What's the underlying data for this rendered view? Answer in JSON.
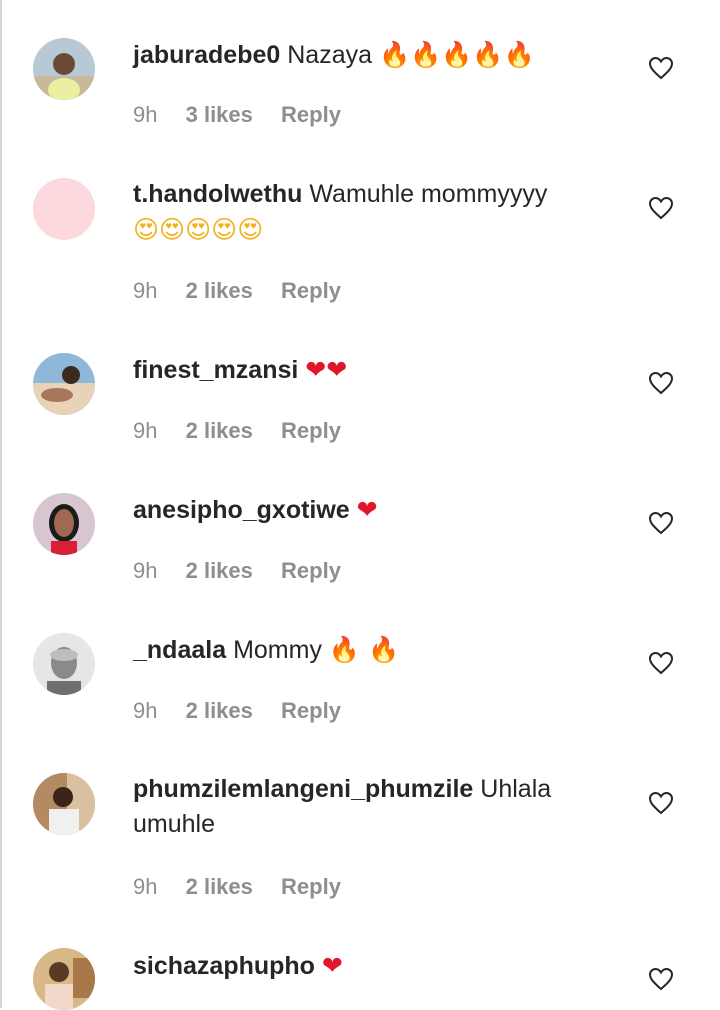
{
  "comments": [
    {
      "username": "jaburadebe0",
      "text": "Nazaya",
      "emoji": "🔥🔥🔥🔥🔥",
      "emoji_kind": "fire",
      "time": "9h",
      "likes": "3 likes",
      "reply": "Reply",
      "avatar_color": "#c9b89a"
    },
    {
      "username": "t.handolwethu",
      "text": "Wamuhle mommyyyy",
      "emoji": "😍😍😍😍😍",
      "emoji_kind": "smile",
      "time": "9h",
      "likes": "2 likes",
      "reply": "Reply",
      "avatar_color": "#fcd9dc"
    },
    {
      "username": "finest_mzansi",
      "text": "",
      "emoji": "❤❤",
      "emoji_kind": "heart",
      "time": "9h",
      "likes": "2 likes",
      "reply": "Reply",
      "avatar_color": "#8fb8d8"
    },
    {
      "username": "anesipho_gxotiwe",
      "text": "",
      "emoji": "❤",
      "emoji_kind": "heart",
      "time": "9h",
      "likes": "2 likes",
      "reply": "Reply",
      "avatar_color": "#c7a9b6"
    },
    {
      "username": "_ndaala",
      "text": "Mommy",
      "emoji": "🔥 🔥",
      "emoji_kind": "fire",
      "time": "9h",
      "likes": "2 likes",
      "reply": "Reply",
      "avatar_color": "#d6d6d6"
    },
    {
      "username": "phumzilemlangeni_phumzile",
      "text": "Uhlala umuhle",
      "emoji": "",
      "emoji_kind": "none",
      "time": "9h",
      "likes": "2 likes",
      "reply": "Reply",
      "avatar_color": "#b89070"
    },
    {
      "username": "sichazaphupho",
      "text": "",
      "emoji": "❤",
      "emoji_kind": "heart",
      "time": "",
      "likes": "",
      "reply": "",
      "avatar_color": "#c8a070"
    }
  ]
}
